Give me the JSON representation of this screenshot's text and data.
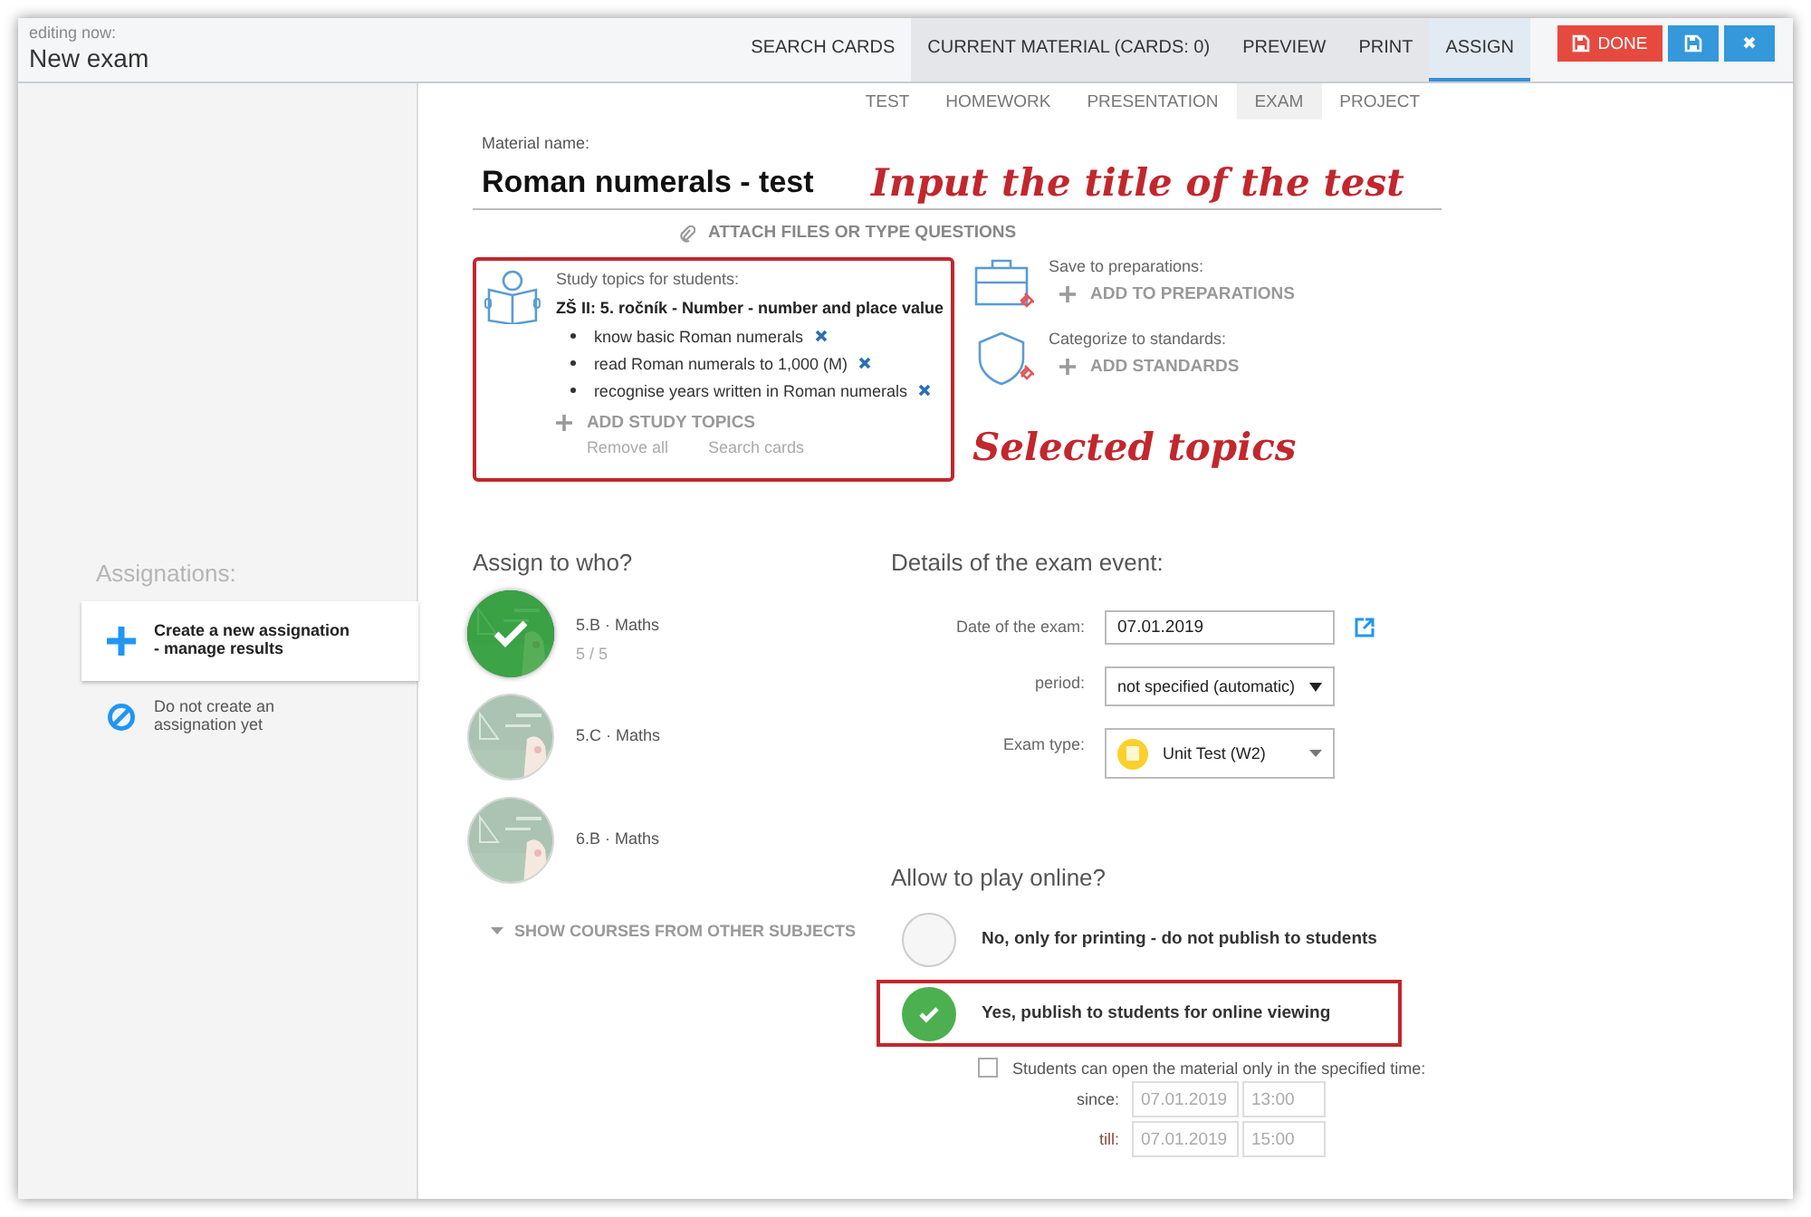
{
  "header": {
    "caption": "editing now:",
    "title": "New exam"
  },
  "nav_tabs": [
    {
      "label": "SEARCH CARDS",
      "selected": false,
      "shaded": false
    },
    {
      "label": "CURRENT MATERIAL (CARDS: 0)",
      "selected": false,
      "shaded": true
    },
    {
      "label": "PREVIEW",
      "selected": false,
      "shaded": true
    },
    {
      "label": "PRINT",
      "selected": false,
      "shaded": true
    },
    {
      "label": "ASSIGN",
      "selected": true,
      "shaded": false
    }
  ],
  "actions": [
    {
      "kind": "done",
      "label": "DONE"
    },
    {
      "kind": "save"
    },
    {
      "kind": "close",
      "label": "✖"
    }
  ],
  "material_types": [
    {
      "label": "TEST",
      "selected": false
    },
    {
      "label": "HOMEWORK",
      "selected": false
    },
    {
      "label": "PRESENTATION",
      "selected": false
    },
    {
      "label": "EXAM",
      "selected": true
    },
    {
      "label": "PROJECT",
      "selected": false
    }
  ],
  "material": {
    "label": "Material name:",
    "value": "Roman numerals - test",
    "annotation": "Input the title of the test"
  },
  "attach": "ATTACH FILES OR TYPE QUESTIONS",
  "study_topics": {
    "label": "Study topics for students:",
    "heading": "ZŠ II: 5. ročník - Number - number and place value",
    "items": [
      "know basic Roman numerals",
      "read Roman numerals to 1,000 (M)",
      "recognise years written in Roman numerals"
    ],
    "add": "ADD STUDY TOPICS",
    "remove_all": "Remove all",
    "search": "Search cards",
    "annotation": "Selected topics"
  },
  "preparations": {
    "label": "Save to preparations:",
    "add": "ADD TO PREPARATIONS"
  },
  "standards": {
    "label": "Categorize to standards:",
    "add": "ADD STANDARDS"
  },
  "sidebar": {
    "title": "Assignations:",
    "items": [
      {
        "kind": "create",
        "text": "Create a new assignation\n- manage results",
        "selected": true
      },
      {
        "kind": "none",
        "text": "Do not create an\nassignation yet",
        "selected": false
      }
    ]
  },
  "assign": {
    "title": "Assign to who?",
    "classes": [
      {
        "name": "5.B · Maths",
        "count": "5 / 5",
        "selected": true
      },
      {
        "name": "5.C · Maths",
        "selected": false
      },
      {
        "name": "6.B · Maths",
        "selected": false
      }
    ],
    "more": "SHOW COURSES FROM OTHER SUBJECTS"
  },
  "details": {
    "title": "Details of the exam event:",
    "date": {
      "label": "Date of the exam:",
      "value": "07.01.2019"
    },
    "period": {
      "label": "period:",
      "value": "not specified (automatic)"
    },
    "exam_type": {
      "label": "Exam type:",
      "value": "Unit Test (W2)"
    }
  },
  "online": {
    "title": "Allow to play online?",
    "options": [
      {
        "label": "No, only for printing - do not publish to students",
        "selected": false,
        "annotated": false
      },
      {
        "label": "Yes, publish to students for online viewing",
        "selected": true,
        "annotated": true
      }
    ],
    "restrict": {
      "label": "Students can open the material only in the specified time:",
      "checked": false
    },
    "since": {
      "label": "since:",
      "date": "07.01.2019",
      "time": "13:00"
    },
    "till": {
      "label": "till:",
      "date": "07.01.2019",
      "time": "15:00"
    }
  }
}
